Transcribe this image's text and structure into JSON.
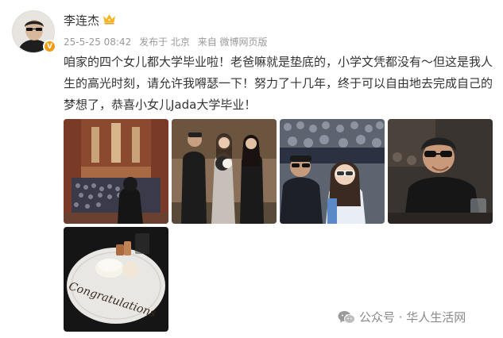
{
  "post": {
    "username": "李连杰",
    "avatar_icon": "user-avatar",
    "verified_badge": "V",
    "crown_icon": "crown-icon",
    "date": "25-5-25 08:42",
    "location": "发布于 北京",
    "source": "来自 微博网页版",
    "text": "咱家的四个女儿都大学毕业啦！老爸嘛就是垫底的，小学文凭都没有～但这是我人生的高光时刻，请允许我嘚瑟一下！努力了十几年，终于可以自由地去完成自己的梦想了，恭喜小女儿Jada大学毕业！",
    "photos": [
      {
        "icon": "graduation-hall-photo"
      },
      {
        "icon": "family-portrait-photo"
      },
      {
        "icon": "ceremony-selfie-photo"
      },
      {
        "icon": "dinner-portrait-photo"
      },
      {
        "icon": "congratulations-dessert-photo"
      }
    ],
    "cake_text": "Congratulations"
  },
  "watermark": {
    "icon": "wechat-icon",
    "text": "公众号 · 华人生活网"
  },
  "colors": {
    "badge": "#f39c12",
    "crown": "#f5b423",
    "meta_text": "#999999"
  }
}
